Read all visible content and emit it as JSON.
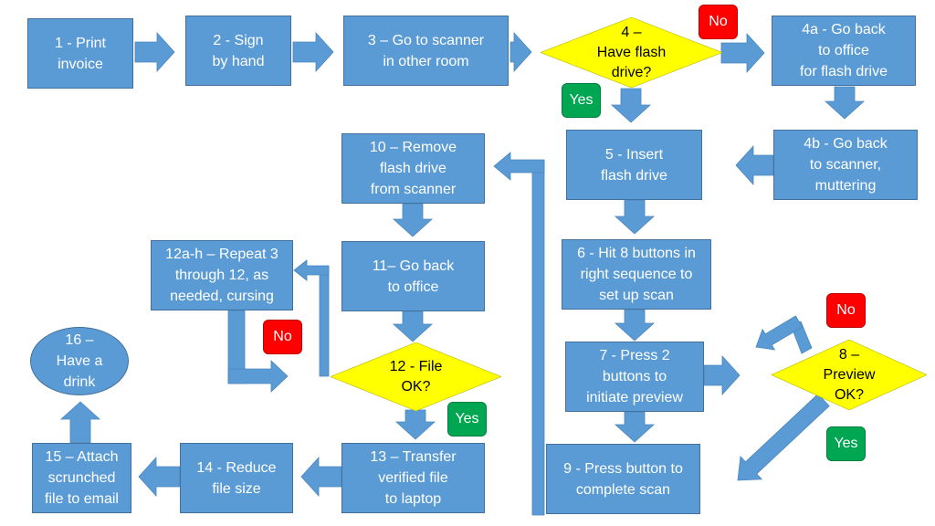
{
  "colors": {
    "process": "#5b9bd5",
    "process_border": "#41719c",
    "decision": "#ffff00",
    "no_badge": "#ff0000",
    "yes_badge": "#00a651",
    "arrow": "#5b9bd5"
  },
  "steps": {
    "s1": "1 - Print\ninvoice",
    "s2": "2 - Sign\nby hand",
    "s3": "3 – Go to scanner\nin other room",
    "s4": "4 –\nHave flash\ndrive?",
    "s4a": "4a - Go back\nto office\nfor flash drive",
    "s4b": "4b - Go back\nto scanner,\nmuttering",
    "s5": "5 - Insert\nflash drive",
    "s6": "6 - Hit 8 buttons in\nright sequence to\nset up scan",
    "s7": "7 - Press 2\nbuttons to\ninitiate preview",
    "s8": "8 –\nPreview\nOK?",
    "s9": "9 - Press button to\ncomplete scan",
    "s10": "10 – Remove\nflash drive\nfrom scanner",
    "s11": "11– Go back\nto office",
    "s12": "12 - File\nOK?",
    "s12ah": "12a-h – Repeat 3\nthrough 12, as\nneeded, cursing",
    "s13": "13 – Transfer\nverified file\nto laptop",
    "s14": "14 - Reduce\nfile size",
    "s15": "15 – Attach\nscrunched\nfile to email",
    "s16": "16 –\nHave a\ndrink"
  },
  "badges": {
    "no4": "No",
    "yes4": "Yes",
    "no8": "No",
    "yes8": "Yes",
    "no12": "No",
    "yes12": "Yes"
  }
}
